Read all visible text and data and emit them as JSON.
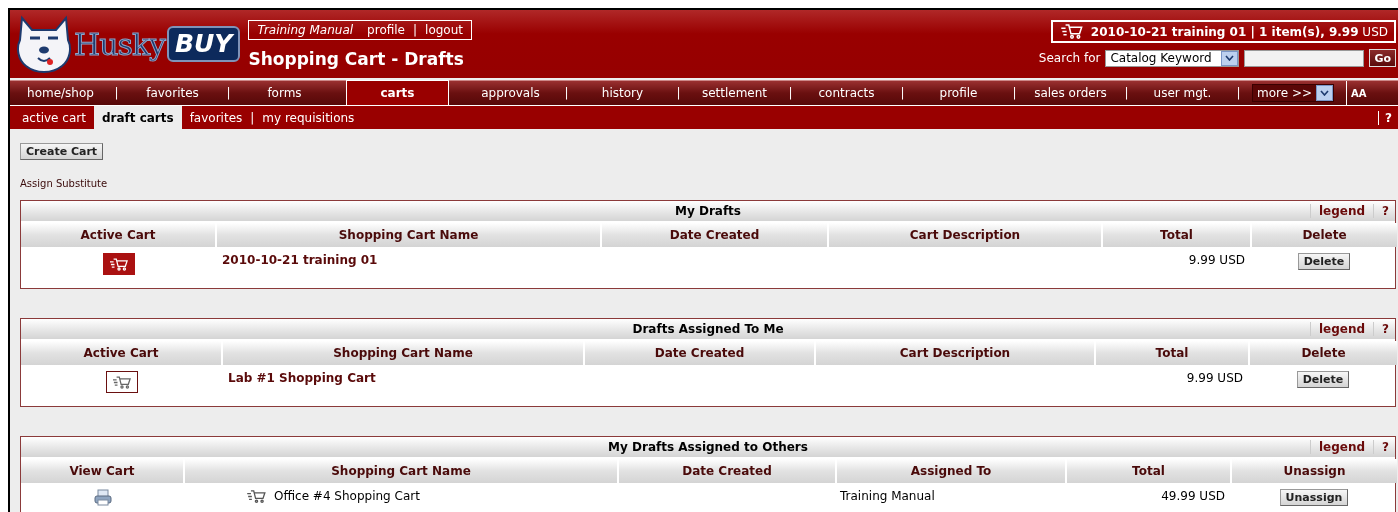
{
  "header": {
    "logo": {
      "word": "Husky",
      "badge": "BUY"
    },
    "user_menu": {
      "name": "Training Manual",
      "links": [
        "profile",
        "logout"
      ],
      "separator": "|"
    },
    "page_title": "Shopping Cart - Drafts",
    "cart_summary": "**2010-10-21 training 01 | 1 item(s), 9.99** USD",
    "search": {
      "label": "Search for",
      "scope": "Catalog Keyword",
      "go": "Go"
    }
  },
  "nav": {
    "separator": "|",
    "tabs": [
      {
        "label": "home/shop",
        "selected": false
      },
      {
        "label": "favorites",
        "selected": false
      },
      {
        "label": "forms",
        "selected": false
      },
      {
        "label": "carts",
        "selected": true
      },
      {
        "label": "approvals",
        "selected": false
      },
      {
        "label": "history",
        "selected": false
      },
      {
        "label": "settlement",
        "selected": false
      },
      {
        "label": "contracts",
        "selected": false
      },
      {
        "label": "profile",
        "selected": false
      },
      {
        "label": "sales orders",
        "selected": false
      },
      {
        "label": "user mgt.",
        "selected": false
      }
    ],
    "more": "more >>",
    "text_size": "AA"
  },
  "subnav": {
    "separator": "|",
    "help": "?",
    "tabs": [
      {
        "label": "active cart",
        "selected": false
      },
      {
        "label": "draft carts",
        "selected": true
      },
      {
        "label": "favorites",
        "selected": false
      },
      {
        "label": "my requisitions",
        "selected": false
      }
    ]
  },
  "create_cart": "Create Cart",
  "assign_substitute": "Assign Substitute",
  "sections": [
    {
      "title": "My Drafts",
      "legend": "legend",
      "help": "?",
      "columns": [
        {
          "label": "Active Cart",
          "kind": "active"
        },
        {
          "label": "Shopping Cart Name",
          "kind": "name"
        },
        {
          "label": "Date Created",
          "kind": "empty"
        },
        {
          "label": "Cart Description",
          "kind": "empty"
        },
        {
          "label": "Total",
          "kind": "total"
        },
        {
          "label": "Delete",
          "kind": "button"
        }
      ],
      "rows": [
        {
          "active": true,
          "name": "2010-10-21 training 01",
          "total": "9.99 USD",
          "button": "Delete"
        }
      ]
    },
    {
      "title": "Drafts Assigned To Me",
      "legend": "legend",
      "help": "?",
      "columns": [
        {
          "label": "Active Cart",
          "kind": "active"
        },
        {
          "label": "Shopping Cart Name",
          "kind": "name"
        },
        {
          "label": "Date Created",
          "kind": "empty"
        },
        {
          "label": "Cart Description",
          "kind": "empty"
        },
        {
          "label": "Total",
          "kind": "total"
        },
        {
          "label": "Delete",
          "kind": "button"
        }
      ],
      "rows": [
        {
          "active": false,
          "name": "Lab #1 Shopping Cart",
          "total": "9.99 USD",
          "button": "Delete"
        }
      ]
    },
    {
      "title": "My Drafts Assigned to Others",
      "legend": "legend",
      "help": "?",
      "columns": [
        {
          "label": "View Cart",
          "kind": "view"
        },
        {
          "label": "Shopping Cart Name",
          "kind": "cart_name"
        },
        {
          "label": "Date Created",
          "kind": "empty"
        },
        {
          "label": "Assigned To",
          "kind": "assigned"
        },
        {
          "label": "Total",
          "kind": "total"
        },
        {
          "label": "Unassign",
          "kind": "button"
        }
      ],
      "rows": [
        {
          "name": "Office #4 Shopping Cart",
          "assigned_to": "Training Manual",
          "total": "49.99 USD",
          "button": "Unassign"
        }
      ]
    }
  ]
}
